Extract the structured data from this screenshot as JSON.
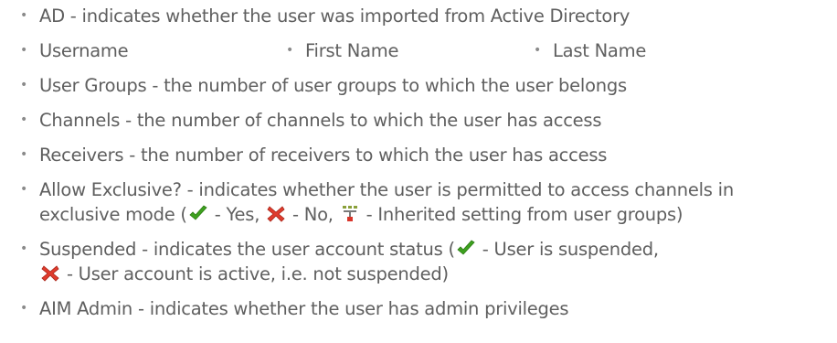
{
  "items": [
    {
      "text": "AD - indicates whether the user was imported from Active Directory"
    },
    {
      "columns": [
        "Username",
        "First Name",
        "Last Name"
      ]
    },
    {
      "text": "User Groups - the number of user groups to which the user belongs"
    },
    {
      "text": "Channels - the number of channels to which the user has access"
    },
    {
      "text": "Receivers - the number of receivers to which the user has access"
    },
    {
      "line1": "Allow Exclusive? - indicates whether the user is permitted to access channels in",
      "line2_pre": "exclusive mode (",
      "yes": " - Yes, ",
      "no": " - No, ",
      "inherited": " - Inherited setting from user groups)"
    },
    {
      "line1_pre": "Suspended - indicates the user account status (",
      "line1_post": " - User is suspended,",
      "line2_post": " - User account is active, i.e. not suspended)"
    },
    {
      "text": "AIM Admin - indicates whether the user has admin privileges"
    }
  ],
  "colors": {
    "text": "#5f5f5f",
    "bullet": "#8a8a8a",
    "check": "#3ea11f",
    "cross": "#e03c2e"
  },
  "icons": [
    "checkmark-icon",
    "cross-icon",
    "inherited-tree-icon"
  ]
}
